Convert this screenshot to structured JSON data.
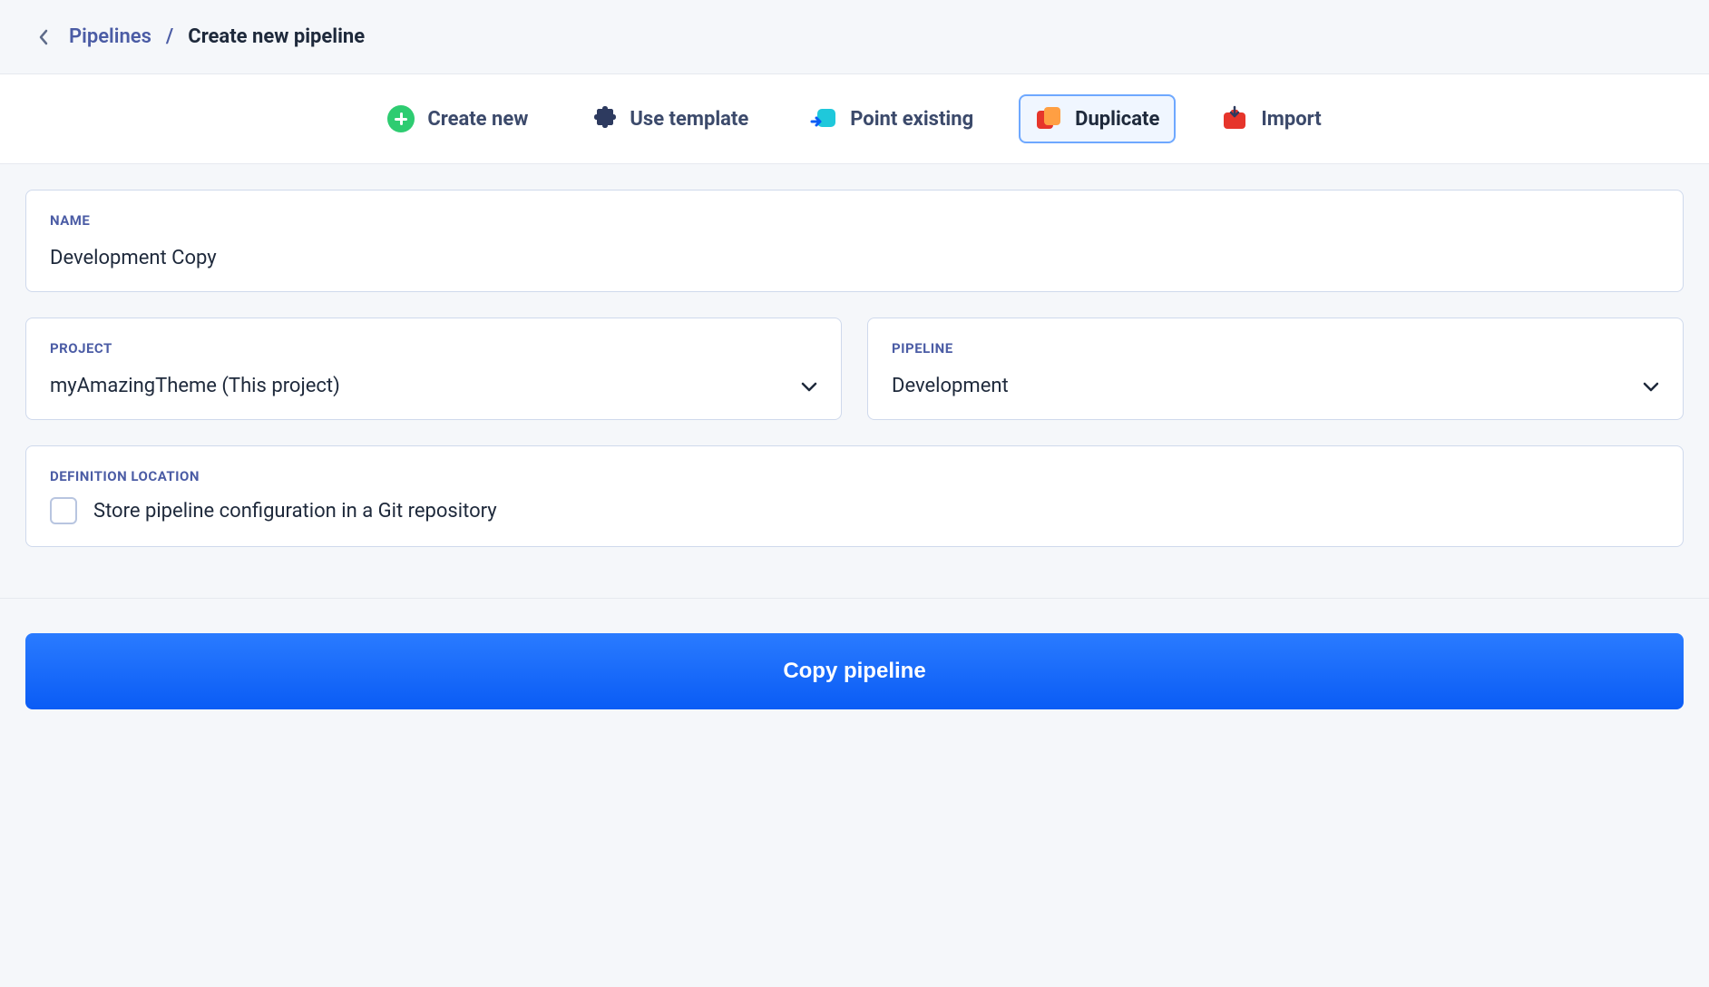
{
  "breadcrumb": {
    "parent": "Pipelines",
    "current": "Create new pipeline"
  },
  "tabs": {
    "create_new": "Create new",
    "use_template": "Use template",
    "point_existing": "Point existing",
    "duplicate": "Duplicate",
    "import": "Import"
  },
  "form": {
    "name_label": "NAME",
    "name_value": "Development Copy",
    "project_label": "PROJECT",
    "project_value": "myAmazingTheme (This project)",
    "pipeline_label": "PIPELINE",
    "pipeline_value": "Development",
    "definition_label": "DEFINITION LOCATION",
    "definition_checkbox_label": "Store pipeline configuration in a Git repository"
  },
  "footer": {
    "submit_label": "Copy pipeline"
  }
}
